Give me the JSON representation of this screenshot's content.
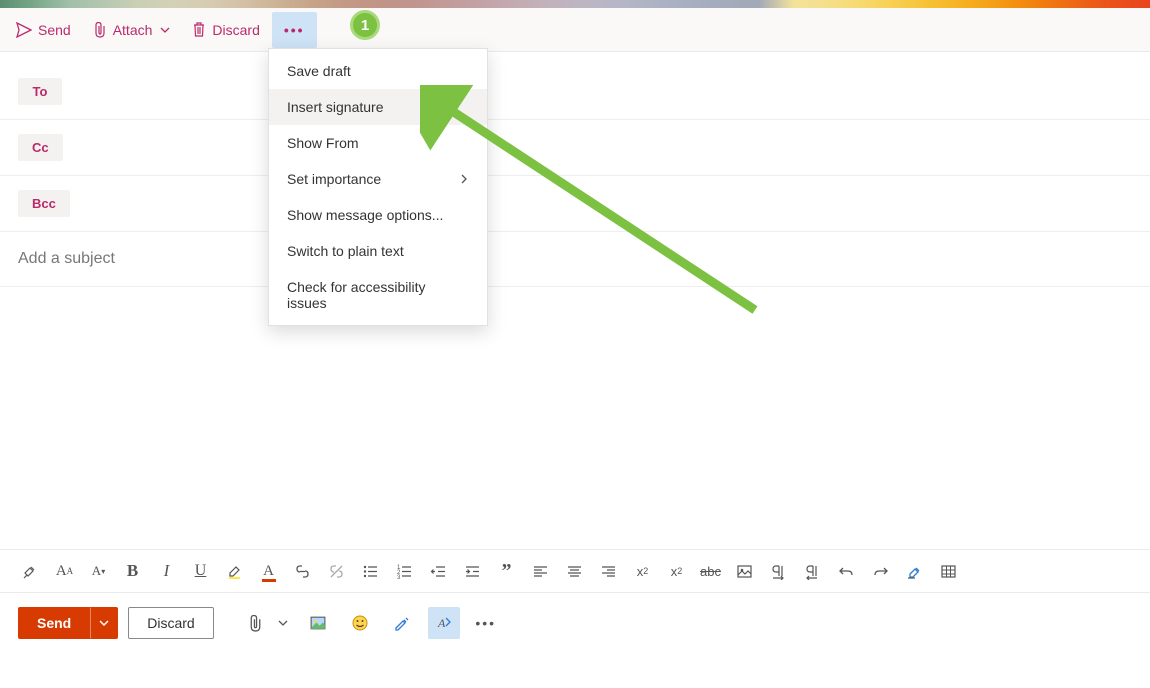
{
  "toolbar": {
    "send": "Send",
    "attach": "Attach",
    "discard": "Discard"
  },
  "recipients": {
    "to": "To",
    "cc": "Cc",
    "bcc": "Bcc"
  },
  "subject_placeholder": "Add a subject",
  "dropdown": {
    "items": [
      {
        "label": "Save draft",
        "submenu": false
      },
      {
        "label": "Insert signature",
        "submenu": false,
        "highlighted": true
      },
      {
        "label": "Show From",
        "submenu": false
      },
      {
        "label": "Set importance",
        "submenu": true
      },
      {
        "label": "Show message options...",
        "submenu": false
      },
      {
        "label": "Switch to plain text",
        "submenu": false
      },
      {
        "label": "Check for accessibility issues",
        "submenu": false
      }
    ]
  },
  "actions": {
    "send": "Send",
    "discard": "Discard"
  },
  "annotation": {
    "badge": "1"
  },
  "format_icons": [
    "format-painter",
    "font-size-increase",
    "font-size-decrease",
    "bold",
    "italic",
    "underline",
    "highlight",
    "font-color",
    "link",
    "unlink",
    "bullets",
    "numbering",
    "outdent",
    "indent",
    "quote",
    "align-left",
    "align-center",
    "align-right",
    "superscript",
    "subscript",
    "strikethrough",
    "insert-picture",
    "ltr",
    "rtl",
    "undo",
    "redo",
    "clear-formatting",
    "table"
  ],
  "action_icons": [
    "attach",
    "attach-more",
    "picture",
    "emoji",
    "ink",
    "show-formatting",
    "more"
  ]
}
